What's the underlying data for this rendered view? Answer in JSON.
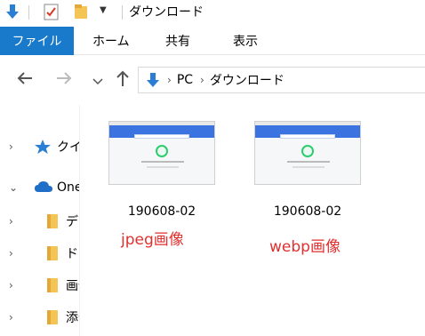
{
  "window": {
    "title": "ダウンロード"
  },
  "ribbon": {
    "file_tab": "ファイル",
    "tabs": [
      "ホーム",
      "共有",
      "表示"
    ]
  },
  "address": {
    "path": [
      "PC",
      "ダウンロード"
    ]
  },
  "navpane": {
    "items": [
      {
        "label": "クイックアクセス",
        "icon": "star-icon"
      },
      {
        "label": "OneDrive",
        "icon": "cloud-icon"
      },
      {
        "label": "デスクトップ",
        "icon": "folder-icon"
      },
      {
        "label": "ドキュメント",
        "icon": "folder-icon"
      },
      {
        "label": "画像",
        "icon": "folder-icon"
      },
      {
        "label": "添付ファイル",
        "icon": "folder-icon"
      }
    ]
  },
  "files": [
    {
      "name": "190608-02"
    },
    {
      "name": "190608-02"
    }
  ],
  "annotations": [
    "jpeg画像",
    "webp画像"
  ],
  "colors": {
    "accent": "#1979ca",
    "annotation": "#e03030"
  }
}
